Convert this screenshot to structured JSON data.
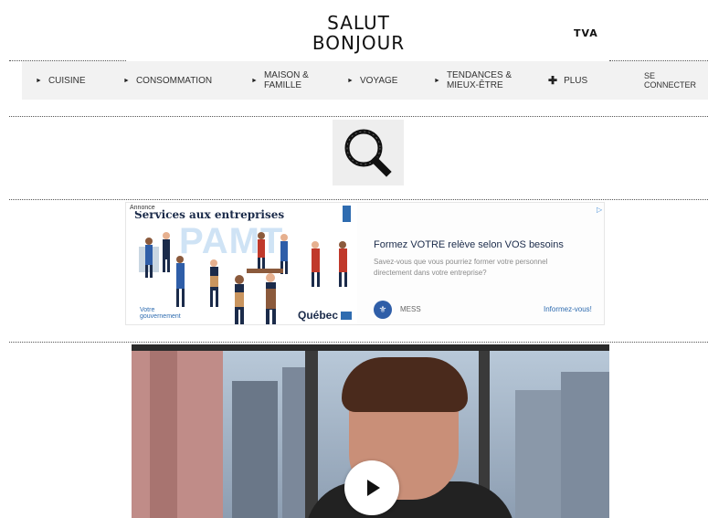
{
  "brand": {
    "logo_line1": "SALUT",
    "logo_line2": "BONJOUR",
    "network_logo": "TVA"
  },
  "nav": {
    "items": [
      {
        "label": "CUISINE",
        "icon": "triangle-right-icon"
      },
      {
        "label": "CONSOMMATION",
        "icon": "triangle-right-icon"
      },
      {
        "label": "MAISON & FAMILLE",
        "icon": "triangle-right-icon"
      },
      {
        "label": "VOYAGE",
        "icon": "triangle-right-icon"
      },
      {
        "label": "TENDANCES & MIEUX-ÊTRE",
        "icon": "triangle-right-icon"
      },
      {
        "label": "PLUS",
        "icon": "plus-icon"
      }
    ],
    "login_label": "SE CONNECTER"
  },
  "search": {
    "icon": "magnifier-icon"
  },
  "ad": {
    "annonce_label": "Annonce",
    "title": "Services aux entreprises",
    "program": "PAMT",
    "gov_label_line1": "Votre",
    "gov_label_line2": "gouvernement",
    "quebec_label": "Québec",
    "headline": "Formez VOTRE relève selon VOS besoins",
    "description": "Savez-vous que vous pourriez former votre personnel directement dans votre entreprise?",
    "advertiser": "MESS",
    "cta": "Informez-vous!",
    "colors": {
      "accent": "#2f6cb0",
      "headline": "#1b2b4a"
    }
  },
  "video": {
    "play_icon": "play-icon"
  }
}
